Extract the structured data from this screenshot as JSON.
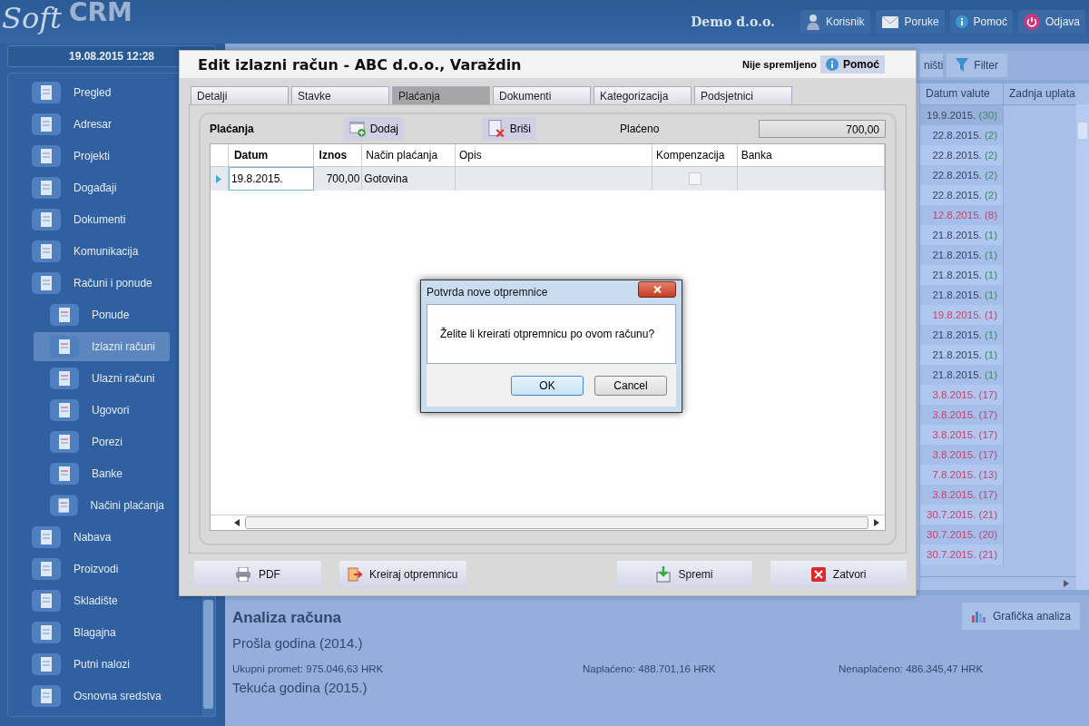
{
  "header": {
    "logo_script": "Soft",
    "logo_bold": "CRM",
    "company": "Demo d.o.o.",
    "actions": [
      {
        "kind": "user",
        "label": "Korisnik"
      },
      {
        "kind": "mail",
        "label": "Poruke"
      },
      {
        "kind": "info",
        "label": "Pomoć"
      },
      {
        "kind": "power",
        "label": "Odjava"
      }
    ]
  },
  "datetime": "19.08.2015 12:28",
  "sidebar": {
    "items": [
      {
        "label": "Pregled",
        "selected": false
      },
      {
        "label": "Adresar",
        "selected": false
      },
      {
        "label": "Projekti",
        "selected": false
      },
      {
        "label": "Događaji",
        "selected": false
      },
      {
        "label": "Dokumenti",
        "selected": false
      },
      {
        "label": "Komunikacija",
        "selected": false
      },
      {
        "label": "Računi i ponude",
        "selected": false,
        "children": [
          {
            "label": "Ponude",
            "selected": false
          },
          {
            "label": "Izlazni računi",
            "selected": true
          },
          {
            "label": "Ulazni računi",
            "selected": false
          },
          {
            "label": "Ugovori",
            "selected": false
          },
          {
            "label": "Porezi",
            "selected": false
          },
          {
            "label": "Banke",
            "selected": false
          },
          {
            "label": "Načini plaćanja",
            "selected": false
          }
        ]
      },
      {
        "label": "Nabava",
        "selected": false
      },
      {
        "label": "Proizvodi",
        "selected": false
      },
      {
        "label": "Skladište",
        "selected": false
      },
      {
        "label": "Blagajna",
        "selected": false
      },
      {
        "label": "Putni nalozi",
        "selected": false
      },
      {
        "label": "Osnovna sredstva",
        "selected": false
      }
    ]
  },
  "toolbar": {
    "buttons": [
      {
        "kind": "plain",
        "label": "ništi"
      },
      {
        "kind": "filter",
        "label": "Filter"
      }
    ]
  },
  "grid": {
    "columns": [
      "Datum valute",
      "Zadnja uplata"
    ],
    "rows": [
      {
        "date": "19.9.2015.",
        "days": "(30)",
        "overdue": false,
        "selected": true
      },
      {
        "date": "22.8.2015.",
        "days": "(2)",
        "overdue": false,
        "selected": false
      },
      {
        "date": "22.8.2015.",
        "days": "(2)",
        "overdue": false,
        "selected": false
      },
      {
        "date": "22.8.2015.",
        "days": "(2)",
        "overdue": false,
        "selected": false
      },
      {
        "date": "22.8.2015.",
        "days": "(2)",
        "overdue": false,
        "selected": false
      },
      {
        "date": "12.8.2015.",
        "days": "(8)",
        "overdue": true,
        "selected": false
      },
      {
        "date": "21.8.2015.",
        "days": "(1)",
        "overdue": false,
        "selected": false
      },
      {
        "date": "21.8.2015.",
        "days": "(1)",
        "overdue": false,
        "selected": false
      },
      {
        "date": "21.8.2015.",
        "days": "(1)",
        "overdue": false,
        "selected": false
      },
      {
        "date": "21.8.2015.",
        "days": "(1)",
        "overdue": false,
        "selected": false
      },
      {
        "date": "19.8.2015.",
        "days": "(1)",
        "overdue": true,
        "selected": false
      },
      {
        "date": "21.8.2015.",
        "days": "(1)",
        "overdue": false,
        "selected": false
      },
      {
        "date": "21.8.2015.",
        "days": "(1)",
        "overdue": false,
        "selected": false
      },
      {
        "date": "21.8.2015.",
        "days": "(1)",
        "overdue": false,
        "selected": false
      },
      {
        "date": "3.8.2015.",
        "days": "(17)",
        "overdue": true,
        "selected": false
      },
      {
        "date": "3.8.2015.",
        "days": "(17)",
        "overdue": true,
        "selected": false
      },
      {
        "date": "3.8.2015.",
        "days": "(17)",
        "overdue": true,
        "selected": false
      },
      {
        "date": "3.8.2015.",
        "days": "(17)",
        "overdue": true,
        "selected": false
      },
      {
        "date": "7.8.2015.",
        "days": "(13)",
        "overdue": true,
        "selected": false
      },
      {
        "date": "3.8.2015.",
        "days": "(17)",
        "overdue": true,
        "selected": false
      },
      {
        "date": "30.7.2015.",
        "days": "(21)",
        "overdue": true,
        "selected": false
      },
      {
        "date": "30.7.2015.",
        "days": "(20)",
        "overdue": true,
        "selected": false
      },
      {
        "date": "30.7.2015.",
        "days": "(21)",
        "overdue": true,
        "selected": false
      }
    ]
  },
  "analysis": {
    "title": "Analiza računa",
    "chart_button": "Grafička analiza",
    "periods": [
      {
        "title": "Prošla godina (2014.)",
        "figures": [
          "Ukupni promet: 975.046,63 HRK",
          "Naplaćeno: 488.701,16 HRK",
          "Nenaplaćeno: 486.345,47 HRK"
        ]
      },
      {
        "title": "Tekuća godina (2015.)"
      }
    ]
  },
  "dialog": {
    "title": "Edit izlazni račun - ABC d.o.o., Varaždin",
    "status": "Nije spremljeno",
    "help": "Pomoć",
    "tabs": [
      {
        "label": "Detalji",
        "selected": false
      },
      {
        "label": "Stavke",
        "selected": false
      },
      {
        "label": "Plaćanja",
        "selected": true
      },
      {
        "label": "Dokumenti",
        "selected": false
      },
      {
        "label": "Kategorizacija",
        "selected": false
      },
      {
        "label": "Podsjetnici",
        "selected": false
      }
    ],
    "payments": {
      "title": "Plaćanja",
      "add": "Dodaj",
      "delete": "Briši",
      "paid_label": "Plaćeno",
      "paid_value": "700,00",
      "columns": [
        {
          "label": "Datum",
          "bold": true
        },
        {
          "label": "Iznos",
          "bold": true
        },
        {
          "label": "Način plaćanja",
          "bold": false
        },
        {
          "label": "Opis",
          "bold": false
        },
        {
          "label": "Kompenzacija",
          "bold": false
        },
        {
          "label": "Banka",
          "bold": false
        }
      ],
      "rows": [
        {
          "date": "19.8.2015.",
          "amount": "700,00",
          "method": "Gotovina",
          "compensation": false,
          "selected": true
        }
      ]
    },
    "buttons": [
      {
        "kind": "pdf",
        "label": "PDF"
      },
      {
        "kind": "delivery",
        "label": "Kreiraj otpremnicu"
      },
      {
        "kind": "save",
        "label": "Spremi"
      },
      {
        "kind": "close",
        "label": "Zatvori"
      }
    ]
  },
  "message_box": {
    "title": "Potvrda nove otpremnice",
    "text": "Želite li kreirati otpremnicu po ovom računu?",
    "buttons": [
      "OK",
      "Cancel"
    ]
  }
}
